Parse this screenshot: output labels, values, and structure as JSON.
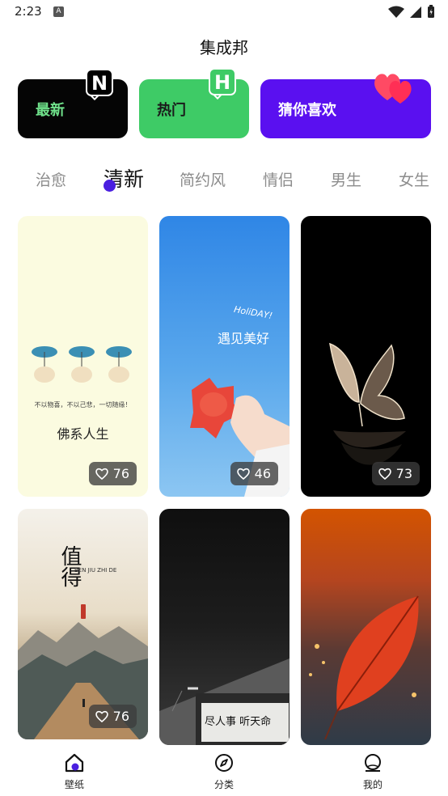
{
  "status": {
    "time": "2:23",
    "notif_letter": "A"
  },
  "app": {
    "title": "集成邦"
  },
  "categories": [
    {
      "label": "最新",
      "badge": "N",
      "bg": "#050505",
      "fg": "#6fe08a"
    },
    {
      "label": "热门",
      "badge": "H",
      "bg": "#3ecb66",
      "fg": "#1b1b1b"
    },
    {
      "label": "猜你喜欢",
      "badge": "heart",
      "bg": "#5a10f0",
      "fg": "#ffffff"
    }
  ],
  "tabs": [
    "治愈",
    "清新",
    "简约风",
    "情侣",
    "男生",
    "女生"
  ],
  "active_tab": "清新",
  "wallpapers": [
    {
      "likes": "76",
      "caption": "佛系人生",
      "subtext": "不以物喜，不以己悲，一切随缘！"
    },
    {
      "likes": "46",
      "caption": "遇见美好",
      "subtext": "HoliDAY!"
    },
    {
      "likes": "73"
    },
    {
      "likes": "76",
      "caption": "值得",
      "subtext": "BEN JIU ZHI DE"
    },
    {
      "caption": "尽人事 听天命",
      "subtext": ""
    },
    {}
  ],
  "nav": [
    {
      "label": "壁纸",
      "icon": "home-icon"
    },
    {
      "label": "分类",
      "icon": "compass-icon"
    },
    {
      "label": "我的",
      "icon": "profile-icon"
    }
  ],
  "colors": {
    "accent": "#4a1fe0",
    "active_tab": "#111111",
    "inactive_tab": "#8c8c8c"
  }
}
